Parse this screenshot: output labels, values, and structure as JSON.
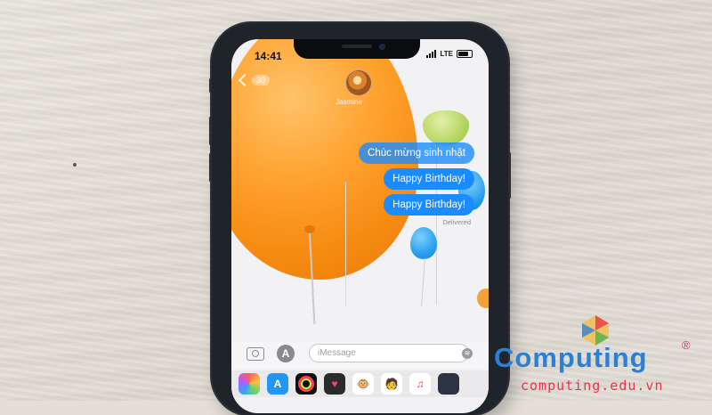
{
  "status_bar": {
    "time": "14:41",
    "network": "LTE"
  },
  "conversation_header": {
    "back_count": "30",
    "contact_name": "Jasmine"
  },
  "messages": [
    {
      "text": "Chúc mừng sinh nhật"
    },
    {
      "text": "Happy Birthday!"
    },
    {
      "text": "Happy Birthday!"
    }
  ],
  "delivery_status": "Delivered",
  "composer": {
    "placeholder": "iMessage"
  },
  "app_drawer": [
    {
      "icon": "photos-icon"
    },
    {
      "icon": "app-store-icon"
    },
    {
      "icon": "activity-icon"
    },
    {
      "icon": "digital-touch-icon"
    },
    {
      "icon": "animoji-monkey-icon"
    },
    {
      "icon": "memoji-icon"
    },
    {
      "icon": "music-icon"
    },
    {
      "icon": "more-apps-icon"
    }
  ],
  "watermark": {
    "brand": "Computing",
    "registered": "®",
    "url": "computing.edu.vn"
  },
  "colors": {
    "bubble_blue": "#1a8cff",
    "balloon_orange": "#f68b12",
    "brand_blue": "#2d7fd6",
    "brand_red": "#e8344a"
  }
}
